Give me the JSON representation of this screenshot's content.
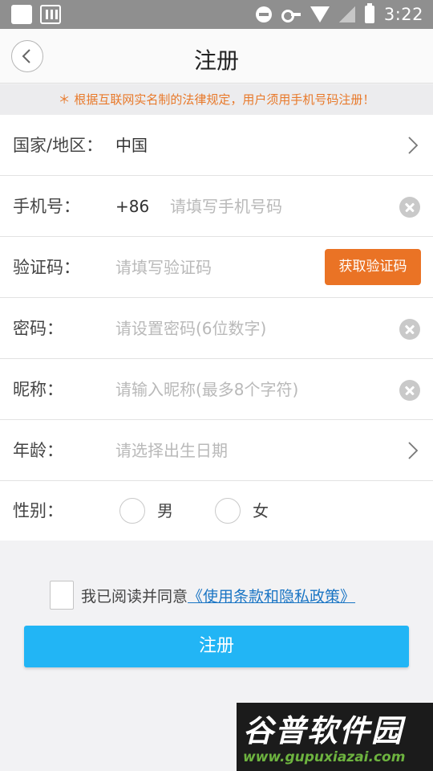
{
  "status_bar": {
    "time": "3:22",
    "icons": [
      "notification-square-icon",
      "app-notification-icon",
      "do-not-disturb-icon",
      "vpn-key-icon",
      "wifi-icon",
      "no-signal-icon",
      "battery-charging-icon"
    ]
  },
  "nav": {
    "title": "注册",
    "back_icon": "chevron-left-icon"
  },
  "notice": "＊ 根据互联网实名制的法律规定，用户须用手机号码注册！",
  "form": {
    "region": {
      "label": "国家/地区：",
      "value": "中国"
    },
    "phone": {
      "label": "手机号：",
      "prefix": "+86",
      "placeholder": "请填写手机号码"
    },
    "code": {
      "label": "验证码：",
      "placeholder": "请填写验证码",
      "button": "获取验证码"
    },
    "password": {
      "label": "密码：",
      "placeholder": "请设置密码(6位数字)"
    },
    "nickname": {
      "label": "昵称：",
      "placeholder": "请输入昵称(最多8个字符)"
    },
    "age": {
      "label": "年龄：",
      "placeholder": "请选择出生日期"
    },
    "gender": {
      "label": "性别：",
      "options": [
        "男",
        "女"
      ],
      "selected": ""
    }
  },
  "agreement": {
    "checked": false,
    "text": "我已阅读并同意",
    "link": "《使用条款和隐私政策》"
  },
  "register_button": "注册",
  "watermark": {
    "title": "谷普软件园",
    "url": "www.gupuxiazai.com"
  },
  "colors": {
    "accent_blue": "#22b5f5",
    "accent_orange": "#ea7325",
    "notice_text": "#e8792a",
    "link": "#1a75c4"
  }
}
